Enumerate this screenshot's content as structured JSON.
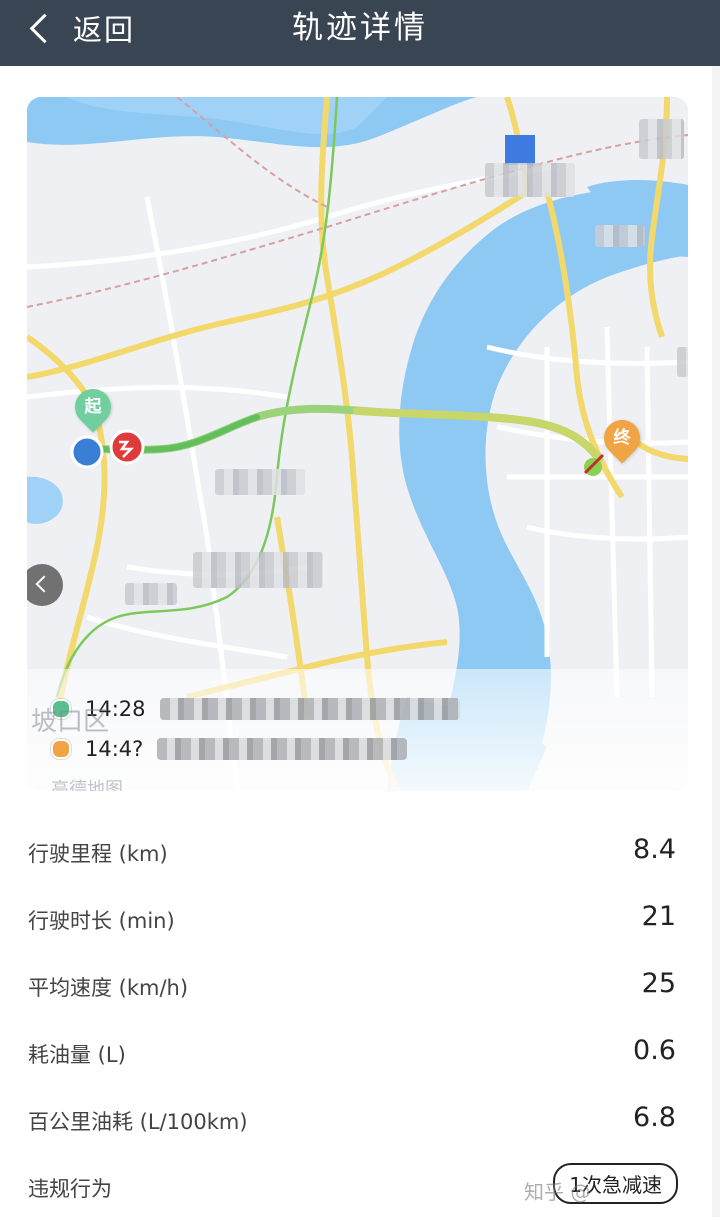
{
  "header": {
    "back_label": "返回",
    "title": "轨迹详情",
    "background": "#3a4553"
  },
  "map": {
    "start_label": "起",
    "end_label": "终",
    "start_color": "#6fcf9e",
    "end_color": "#f0a443",
    "route_color": "#7cc95b",
    "river_color": "#8ec9f4",
    "district_label": "坡口区",
    "brand_label": "高德地图",
    "legend": [
      {
        "time": "14:28",
        "color": "#59c08d"
      },
      {
        "time": "14:4?",
        "color": "#f0a443"
      }
    ]
  },
  "stats": [
    {
      "label": "行驶里程 (km)",
      "value": "8.4"
    },
    {
      "label": "行驶时长 (min)",
      "value": "21"
    },
    {
      "label": "平均速度 (km/h)",
      "value": "25"
    },
    {
      "label": "耗油量 (L)",
      "value": "0.6"
    },
    {
      "label": "百公里油耗 (L/100km)",
      "value": "6.8"
    }
  ],
  "violation": {
    "label": "违规行为",
    "value": "1次急减速"
  },
  "watermark": "知乎 @"
}
